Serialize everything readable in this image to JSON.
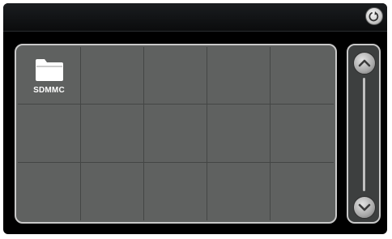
{
  "folder_grid": {
    "items": [
      {
        "label": "SDMMC",
        "icon": "folder-icon"
      }
    ]
  },
  "icons": {
    "back": "return-arrow-icon",
    "scroll_up": "chevron-up-icon",
    "scroll_down": "chevron-down-icon"
  },
  "colors": {
    "panel": "#5f6160",
    "frame": "#c9c9c9",
    "background": "#000000"
  }
}
